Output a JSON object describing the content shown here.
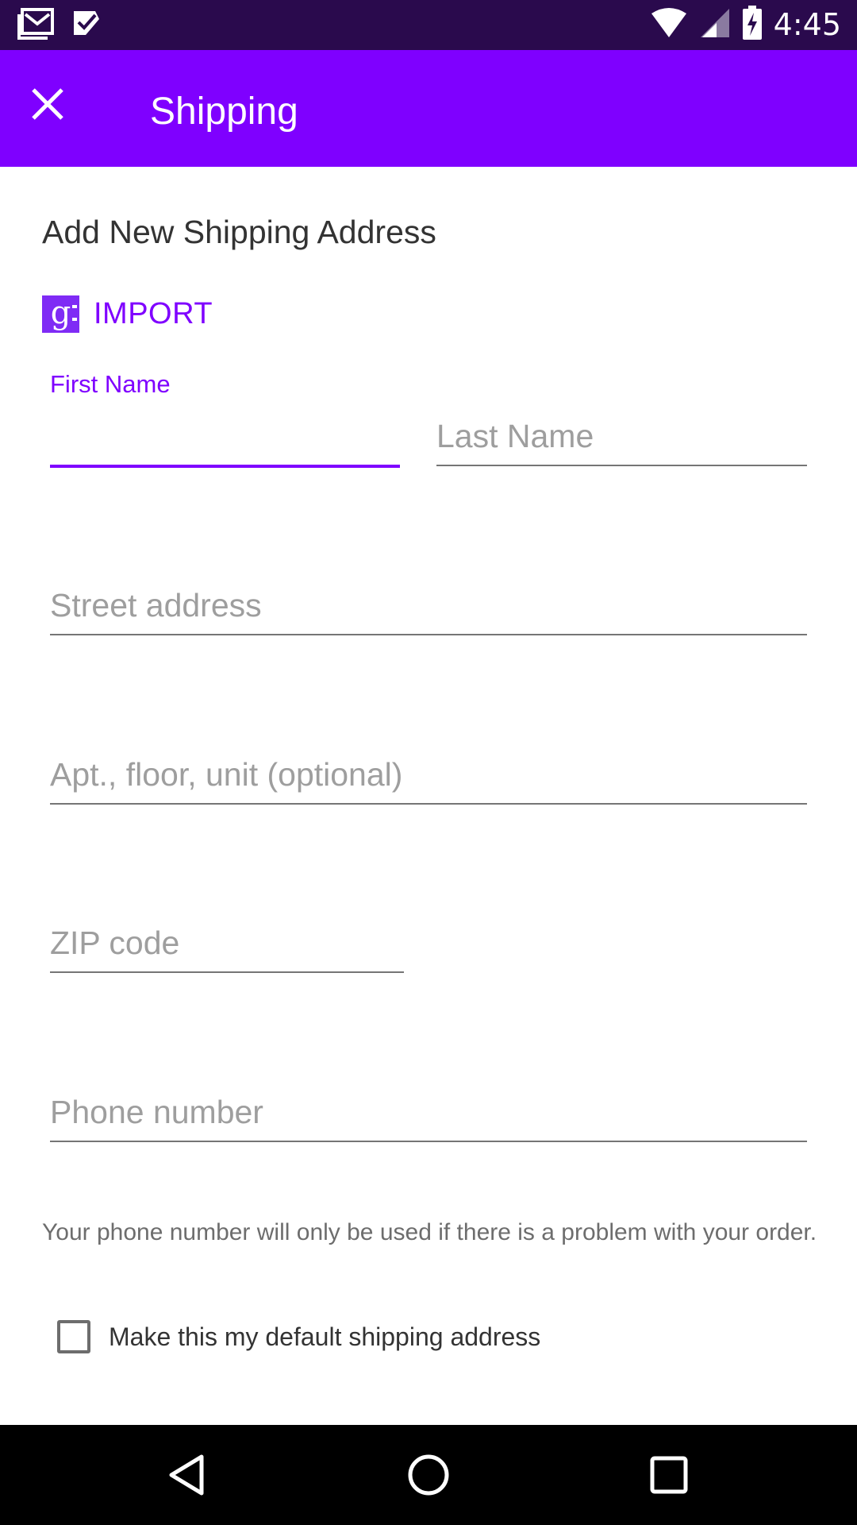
{
  "status_bar": {
    "time": "4:45",
    "icons": [
      "gmail-icon",
      "notification-check-icon",
      "wifi-icon",
      "cell-signal-icon",
      "battery-charging-icon"
    ]
  },
  "app_bar": {
    "title": "Shipping",
    "close_icon": "close-icon",
    "background_color": "#7f00ff"
  },
  "form": {
    "heading": "Add New Shipping Address",
    "import_label": "IMPORT",
    "import_icon": "google-icon",
    "first_name": {
      "label": "First Name",
      "value": ""
    },
    "last_name": {
      "placeholder": "Last Name",
      "value": ""
    },
    "street": {
      "placeholder": "Street address",
      "value": ""
    },
    "apt": {
      "placeholder": "Apt., floor, unit (optional)",
      "value": ""
    },
    "zip": {
      "placeholder": "ZIP code",
      "value": ""
    },
    "phone": {
      "placeholder": "Phone number",
      "value": ""
    },
    "helper_text": "Your phone number will only be used if there is a problem with your order.",
    "default_checkbox": {
      "label": "Make this my default shipping address",
      "checked": false
    }
  },
  "nav_bar": {
    "buttons": [
      "back-icon",
      "home-icon",
      "recents-icon"
    ]
  },
  "colors": {
    "accent": "#7f00ff",
    "status_bar": "#2a0a4d"
  }
}
